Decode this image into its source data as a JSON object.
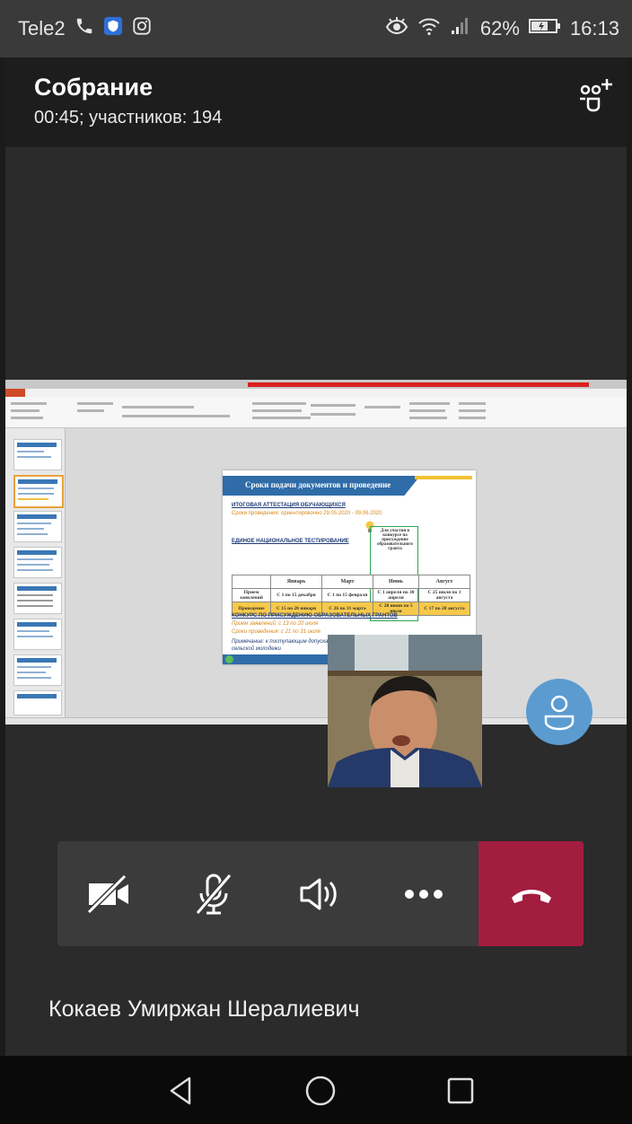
{
  "status_bar": {
    "carrier": "Tele2",
    "battery": "62%",
    "time": "16:13",
    "icons": [
      "phone-icon",
      "shield-app-icon",
      "instagram-icon",
      "eye-icon",
      "wifi-icon",
      "signal-icon",
      "battery-icon"
    ]
  },
  "meeting": {
    "title": "Собрание",
    "subtitle": "00:45; участников: 194"
  },
  "shared_slide": {
    "title": "Сроки подачи документов и проведение",
    "section1_heading": "ИТОГОВАЯ  АТТЕСТАЦИЯ ОБУЧАЮЩИХСЯ",
    "section1_line": "Сроки проведения: ориентировочно  29.05.2020 - 09.06.2020",
    "section2_heading": "ЕДИНОЕ НАЦИОНАЛЬНОЕ ТЕСТИРОВАНИЕ",
    "note": "Для участия в конкурсе на присуждение образовательного гранта",
    "table": {
      "headers": [
        "",
        "Январь",
        "Март",
        "Июнь",
        "Август"
      ],
      "rows": [
        [
          "Прием заявлений",
          "С 1 по 15 декабря",
          "С 1 по 15 февраля",
          "С 1 апреля по 30 апреля",
          "С 25 июля по 1 августа"
        ],
        [
          "Проведение",
          "С 15 по 20 января",
          "С 26 по 31 марта",
          "С 20 июня по 5 июля",
          "С 17 по 20 августа"
        ]
      ]
    },
    "section3_heading": "КОНКУРС ПО ПРИСУЖДЕНИЮ ОБРАЗОВАТЕЛЬНЫХ ГРАНТОВ",
    "section3_line1": "Прием заявлений: с 13 по 20 июля",
    "section3_line2": "Сроки проведения: с 21 по 31 июля",
    "section3_line3": "Примечание: к поступающим допускаются",
    "section3_line4": "сельской молодежи"
  },
  "controls": {
    "camera": "camera-off-icon",
    "mic": "mic-off-icon",
    "speaker": "speaker-icon",
    "more": "more-icon",
    "hangup": "hang-up-icon",
    "hangup_color": "#a31d3e"
  },
  "active_speaker": "Кокаев Умиржан Шералиевич",
  "colors": {
    "accent_blue": "#5b9bd0",
    "slide_blue": "#2f6ca8"
  }
}
